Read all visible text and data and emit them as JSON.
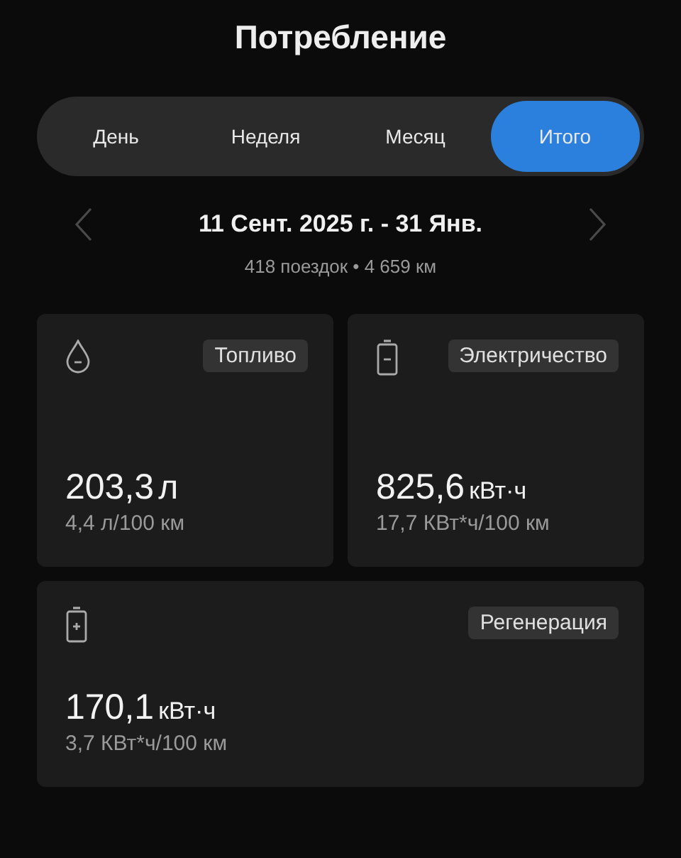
{
  "title": "Потребление",
  "tabs": [
    {
      "label": "День",
      "selected": false
    },
    {
      "label": "Неделя",
      "selected": false
    },
    {
      "label": "Месяц",
      "selected": false
    },
    {
      "label": "Итого",
      "selected": true
    }
  ],
  "period": {
    "range": "11 Сент. 2025 г. - 31 Янв.",
    "summary": "418 поездок • 4 659 км"
  },
  "cards": [
    {
      "kind": "fuel",
      "tag": "Топливо",
      "value": "203,3",
      "unit": "л",
      "rate": "4,4 л/100 км"
    },
    {
      "kind": "battery-minus",
      "tag": "Электричество",
      "value": "825,6",
      "unit": "кВт·ч",
      "rate": "17,7 КВт*ч/100 км"
    },
    {
      "kind": "battery-plus",
      "tag": "Регенерация",
      "value": "170,1",
      "unit": "кВт·ч",
      "rate": "3,7 КВт*ч/100 км"
    }
  ]
}
